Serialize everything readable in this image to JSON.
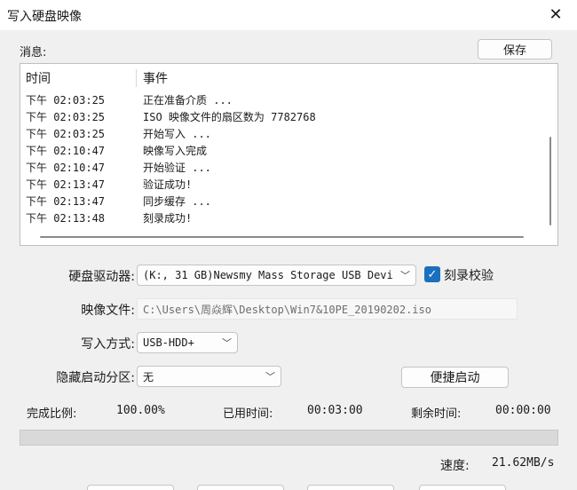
{
  "window": {
    "title": "写入硬盘映像"
  },
  "messages": {
    "label": "消息:",
    "save_label": "保存",
    "columns": [
      "时间",
      "事件"
    ],
    "rows": [
      {
        "time": "下午 02:03:25",
        "event": "正在准备介质 ..."
      },
      {
        "time": "下午 02:03:25",
        "event": "ISO 映像文件的扇区数为 7782768"
      },
      {
        "time": "下午 02:03:25",
        "event": "开始写入 ..."
      },
      {
        "time": "下午 02:10:47",
        "event": "映像写入完成"
      },
      {
        "time": "下午 02:10:47",
        "event": "开始验证 ..."
      },
      {
        "time": "下午 02:13:47",
        "event": "验证成功!"
      },
      {
        "time": "下午 02:13:47",
        "event": "同步缓存 ..."
      },
      {
        "time": "下午 02:13:48",
        "event": "刻录成功!"
      }
    ]
  },
  "form": {
    "drive_label": "硬盘驱动器:",
    "drive_value": "(K:, 31 GB)Newsmy Mass Storage USB Devi",
    "verify_label": "刻录校验",
    "verify_checked": true,
    "image_label": "映像文件:",
    "image_value": "C:\\Users\\周焱辉\\Desktop\\Win7&10PE_20190202.iso",
    "mode_label": "写入方式:",
    "mode_value": "USB-HDD+",
    "hidden_label": "隐藏启动分区:",
    "hidden_value": "无",
    "quick_boot_label": "便捷启动"
  },
  "status": {
    "ratio_label": "完成比例:",
    "ratio_value": "100.00%",
    "progress_fraction": 1.0,
    "elapsed_label": "已用时间:",
    "elapsed_value": "00:03:00",
    "remaining_label": "剩余时间:",
    "remaining_value": "00:00:00",
    "speed_label": "速度:",
    "speed_value": "21.62MB/s"
  },
  "icons": {
    "close": "close-icon",
    "chevron": "chevron-down-icon",
    "check": "check-icon"
  }
}
